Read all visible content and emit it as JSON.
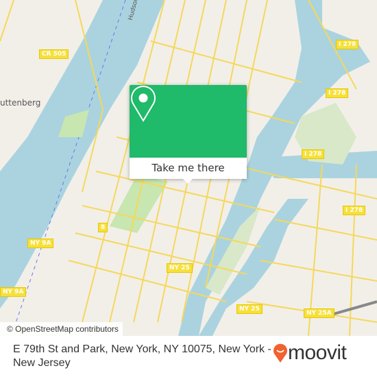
{
  "map": {
    "labels": {
      "river": "Hudson",
      "place": "uttenberg",
      "shields": [
        "CR 505",
        "I 278",
        "I 278",
        "I 278",
        "I 278",
        "8",
        "NY 9A",
        "NY 9A",
        "NY 25",
        "NY 25",
        "NY 25A"
      ]
    },
    "attribution": "© OpenStreetMap contributors",
    "colors": {
      "water": "#aad3df",
      "land": "#f2efe9",
      "park": "#c8e6b0",
      "road": "#f7e03a"
    }
  },
  "popup": {
    "icon": "location-pin-icon",
    "button_label": "Take me there",
    "color": "#1fba6a"
  },
  "footer": {
    "address": "E 79th St and Park, New York, NY 10075, New York - New Jersey",
    "logo_text": "moovit",
    "logo_color": "#f0622f"
  }
}
